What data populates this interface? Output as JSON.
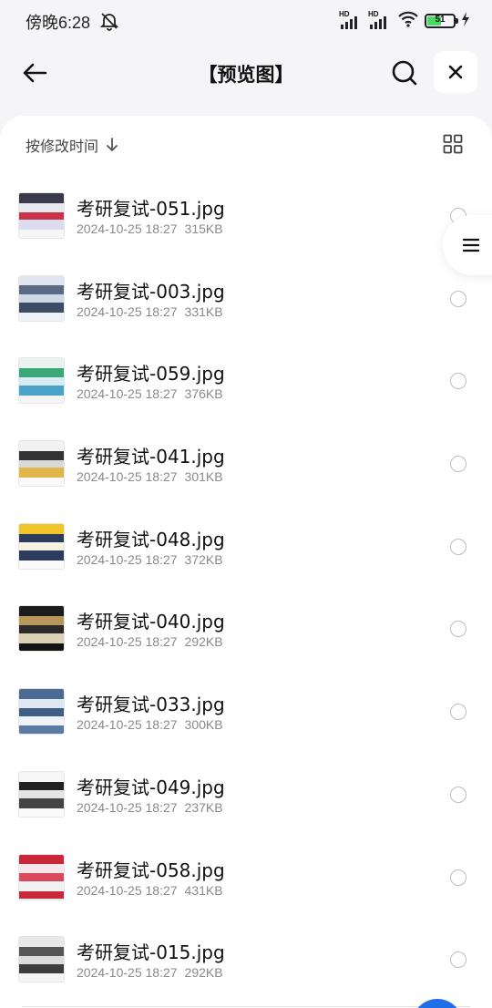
{
  "status_bar": {
    "time": "傍晚6:28",
    "battery_level": "51",
    "battery_fraction": 0.51,
    "signal_badges": [
      "HD",
      "HD"
    ]
  },
  "header": {
    "title": "【预览图】"
  },
  "sort": {
    "label": "按修改时间"
  },
  "files": [
    {
      "name": "考研复试-051.jpg",
      "date": "2024-10-25 18:27",
      "size": "315KB",
      "thumb_colors": [
        "#3a3a4a",
        "#e8e8ef",
        "#c9344a",
        "#dcdcf0",
        "#f6f6f6"
      ]
    },
    {
      "name": "考研复试-003.jpg",
      "date": "2024-10-25 18:27",
      "size": "331KB",
      "thumb_colors": [
        "#dfe6ef",
        "#5a6b85",
        "#cfd8e6",
        "#3d4d66",
        "#eef2f6"
      ]
    },
    {
      "name": "考研复试-059.jpg",
      "date": "2024-10-25 18:27",
      "size": "376KB",
      "thumb_colors": [
        "#e9f3ee",
        "#3ca77a",
        "#d8ecf6",
        "#4aa3c9",
        "#f4f4f4"
      ]
    },
    {
      "name": "考研复试-041.jpg",
      "date": "2024-10-25 18:27",
      "size": "301KB",
      "thumb_colors": [
        "#f2f2f2",
        "#333333",
        "#d9d9d9",
        "#e0b54a",
        "#fafafa"
      ]
    },
    {
      "name": "考研复试-048.jpg",
      "date": "2024-10-25 18:27",
      "size": "372KB",
      "thumb_colors": [
        "#f3c52a",
        "#2d3b5e",
        "#f7f2e0",
        "#2d3b5e",
        "#fafafa"
      ]
    },
    {
      "name": "考研复试-040.jpg",
      "date": "2024-10-25 18:27",
      "size": "292KB",
      "thumb_colors": [
        "#1c1c1c",
        "#b8975a",
        "#2a2a2a",
        "#ded2b6",
        "#141414"
      ]
    },
    {
      "name": "考研复试-033.jpg",
      "date": "2024-10-25 18:27",
      "size": "300KB",
      "thumb_colors": [
        "#4b6b92",
        "#dfe7f1",
        "#3e5e86",
        "#eef3f8",
        "#5b7ba2"
      ]
    },
    {
      "name": "考研复试-049.jpg",
      "date": "2024-10-25 18:27",
      "size": "237KB",
      "thumb_colors": [
        "#f6f6f6",
        "#222222",
        "#e4e4e4",
        "#444444",
        "#fafafa"
      ]
    },
    {
      "name": "考研复试-058.jpg",
      "date": "2024-10-25 18:27",
      "size": "431KB",
      "thumb_colors": [
        "#c8283a",
        "#f6e8ea",
        "#d94a5a",
        "#f2f2f2",
        "#c8283a"
      ]
    },
    {
      "name": "考研复试-015.jpg",
      "date": "2024-10-25 18:27",
      "size": "292KB",
      "thumb_colors": [
        "#e8e8e8",
        "#555555",
        "#dcdcdc",
        "#3d3d3d",
        "#f4f4f4"
      ]
    }
  ],
  "icons": {
    "back": "arrow-left-icon",
    "search": "search-icon",
    "close": "close-icon",
    "sort_direction": "arrow-down-icon",
    "grid_view": "grid-icon",
    "side_menu": "menu-icon"
  },
  "colors": {
    "accent": "#1e6fe8",
    "battery_fill": "#4cd964"
  }
}
